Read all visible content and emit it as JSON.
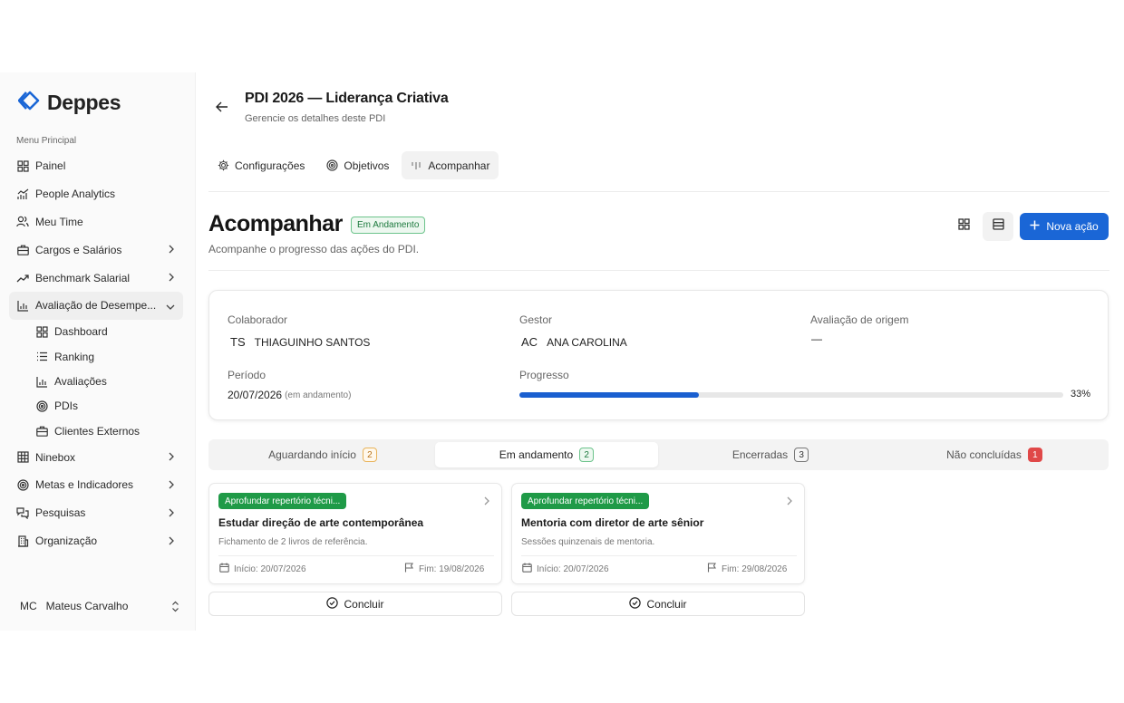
{
  "app": {
    "name": "Deppes",
    "brand_color": "#1a66d6"
  },
  "sidebar": {
    "section_label": "Menu Principal",
    "items": [
      {
        "label": "Painel",
        "icon": "grid-icon"
      },
      {
        "label": "People Analytics",
        "icon": "analytics-icon"
      },
      {
        "label": "Meu Time",
        "icon": "users-icon"
      },
      {
        "label": "Cargos e Salários",
        "icon": "briefcase-icon"
      },
      {
        "label": "Benchmark Salarial",
        "icon": "trending-up-icon"
      },
      {
        "label": "Avaliação de Desempe...",
        "icon": "bar-chart-icon"
      },
      {
        "label": "Ninebox",
        "icon": "grid-nine-icon"
      },
      {
        "label": "Metas e Indicadores",
        "icon": "target-icon"
      },
      {
        "label": "Pesquisas",
        "icon": "messages-icon"
      },
      {
        "label": "Organização",
        "icon": "building-icon"
      }
    ],
    "subitems": [
      {
        "label": "Dashboard",
        "icon": "grid-icon"
      },
      {
        "label": "Ranking",
        "icon": "list-icon"
      },
      {
        "label": "Avaliações",
        "icon": "bar-chart-icon"
      },
      {
        "label": "PDIs",
        "icon": "target-icon"
      },
      {
        "label": "Clientes Externos",
        "icon": "briefcase-icon"
      }
    ],
    "user": {
      "initials": "MC",
      "name": "Mateus Carvalho"
    }
  },
  "header": {
    "title": "PDI 2026 — Liderança Criativa",
    "subtitle": "Gerencie os detalhes deste PDI"
  },
  "tabs": [
    {
      "label": "Configurações",
      "icon": "gear-icon"
    },
    {
      "label": "Objetivos",
      "icon": "target-icon"
    },
    {
      "label": "Acompanhar",
      "icon": "tracking-icon"
    }
  ],
  "section": {
    "title": "Acompanhar",
    "status": "Em Andamento",
    "subtitle": "Acompanhe o progresso das ações do PDI.",
    "new_action_label": "Nova ação"
  },
  "info": {
    "collaborator_label": "Colaborador",
    "collaborator_initials": "TS",
    "collaborator_name": "THIAGUINHO SANTOS",
    "manager_label": "Gestor",
    "manager_initials": "AC",
    "manager_name": "ANA CAROLINA",
    "origin_label": "Avaliação de origem",
    "origin_value": "—",
    "period_label": "Período",
    "period_value": "20/07/2026",
    "period_note": "(em andamento)",
    "progress_label": "Progresso",
    "progress_value": 0.33,
    "progress_text": "33%"
  },
  "status_tabs": [
    {
      "label": "Aguardando início",
      "count": "2"
    },
    {
      "label": "Em andamento",
      "count": "2"
    },
    {
      "label": "Encerradas",
      "count": "3"
    },
    {
      "label": "Não concluídas",
      "count": "1"
    }
  ],
  "cards": [
    {
      "chip": "Aprofundar repertório técni...",
      "title": "Estudar direção de arte contemporânea",
      "description": "Fichamento de 2 livros de referência.",
      "start": "Início: 20/07/2026",
      "end": "Fim: 19/08/2026",
      "button": "Concluir"
    },
    {
      "chip": "Aprofundar repertório técni...",
      "title": "Mentoria com diretor de arte sênior",
      "description": "Sessões quinzenais de mentoria.",
      "start": "Início: 20/07/2026",
      "end": "Fim: 29/08/2026",
      "button": "Concluir"
    }
  ]
}
